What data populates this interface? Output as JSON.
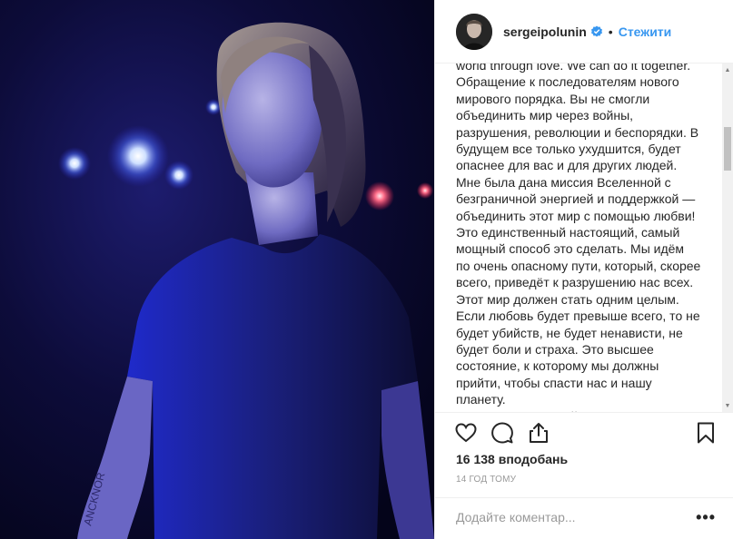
{
  "post": {
    "image_alt": "photo",
    "tattoo_text": "ANCKNOR"
  },
  "header": {
    "username": "sergeipolunin",
    "dot": "•",
    "follow_label": "Стежити"
  },
  "caption": {
    "text": "world through love. We can do it together.\nОбращение к последователям нового мирового порядка. Вы не смогли объединить мир через войны, разрушения, революции и беспорядки. В будущем все только ухудшится, будет опаснее для вас и для других людей. Мне была дана миссия Вселенной с безграничной энергией и поддержкой — объединить этот мир с помощью любви! Это единственный настоящий, самый мощный способ это сделать. Мы идём по очень опасному пути, который, скорее всего, приведёт к разрушению нас всех. Этот мир должен стать одним целым. Если любовь будет превыше всего, то не будет убийств, не будет ненависти, не будет боли и страха. Это высшее состояние, к которому мы должны прийти, чтобы спасти нас и нашу планету.\nЯ прошу всех людей помочь мне"
  },
  "actions": {
    "like_icon": "heart-icon",
    "comment_icon": "comment-icon",
    "share_icon": "share-icon",
    "save_icon": "bookmark-icon"
  },
  "likes": {
    "text": "16 138 вподобань"
  },
  "timestamp": {
    "text": "14 ГОД ТОМУ"
  },
  "comment": {
    "placeholder": "Додайте коментар...",
    "more_label": "•••"
  },
  "colors": {
    "accent": "#3897f0",
    "text": "#262626",
    "muted": "#999999",
    "border": "#efefef"
  }
}
